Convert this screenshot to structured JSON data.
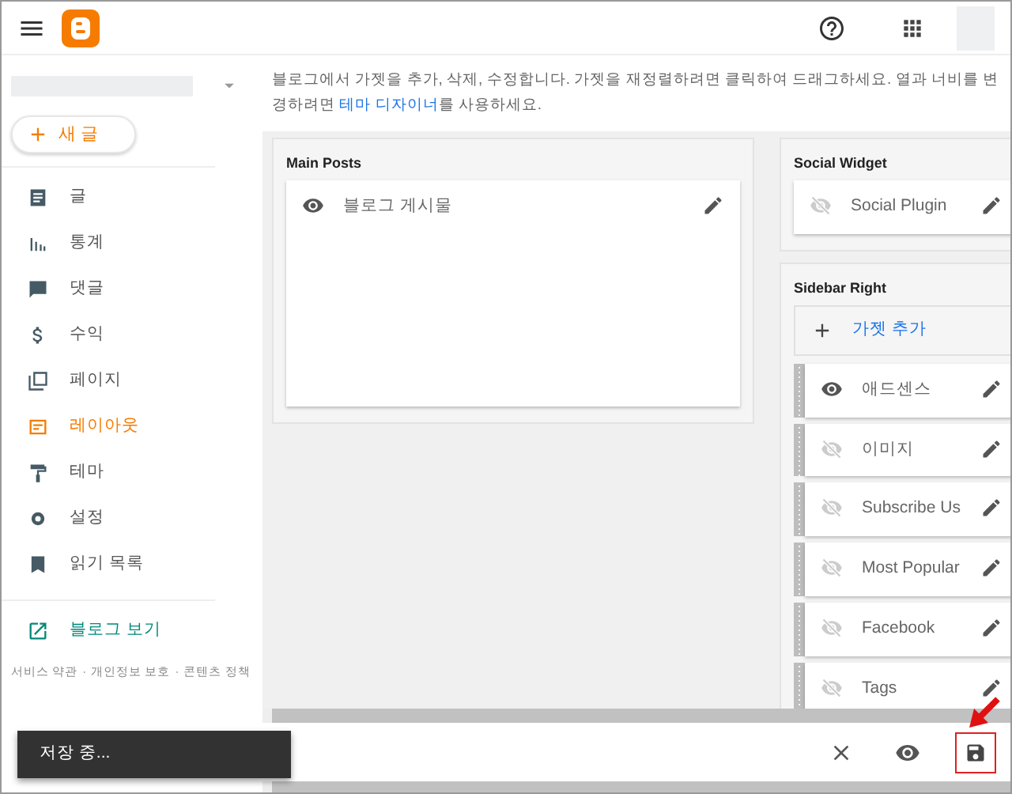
{
  "sidebar": {
    "new_post": "새 글",
    "nav": [
      {
        "label": "글",
        "selected": false
      },
      {
        "label": "통계",
        "selected": false
      },
      {
        "label": "댓글",
        "selected": false
      },
      {
        "label": "수익",
        "selected": false
      },
      {
        "label": "페이지",
        "selected": false
      },
      {
        "label": "레이아웃",
        "selected": true
      },
      {
        "label": "테마",
        "selected": false
      },
      {
        "label": "설정",
        "selected": false
      },
      {
        "label": "읽기 목록",
        "selected": false
      }
    ],
    "view_blog": "블로그 보기",
    "footer_links": [
      "서비스 약관",
      "개인정보 보호",
      "콘텐츠 정책"
    ],
    "footer_separator": "·"
  },
  "intro": {
    "before": "블로그에서 가젯을 추가, 삭제, 수정합니다. 가젯을 재정렬하려면 클릭하여 드래그하세요. 열과 너비를 변경하려면 ",
    "link": "테마 디자이너",
    "after": "를 사용하세요."
  },
  "columns": [
    {
      "sections": [
        {
          "title": "Main Posts",
          "draggable": false,
          "tall": true,
          "widgets": [
            {
              "label": "블로그 게시물",
              "visible": true
            }
          ]
        }
      ]
    },
    {
      "sections": [
        {
          "title": "Social Widget",
          "draggable": false,
          "tall": false,
          "widgets": [
            {
              "label": "Social Plugin",
              "visible": false
            }
          ]
        },
        {
          "title": "Sidebar Right",
          "draggable": true,
          "tall": false,
          "add_gadget": "가젯 추가",
          "widgets": [
            {
              "label": "애드센스",
              "visible": true
            },
            {
              "label": "이미지",
              "visible": false
            },
            {
              "label": "Subscribe Us",
              "visible": false
            },
            {
              "label": "Most Popular",
              "visible": false
            },
            {
              "label": "Facebook",
              "visible": false
            },
            {
              "label": "Tags",
              "visible": false
            }
          ]
        }
      ]
    }
  ],
  "toast": "저장 중..."
}
